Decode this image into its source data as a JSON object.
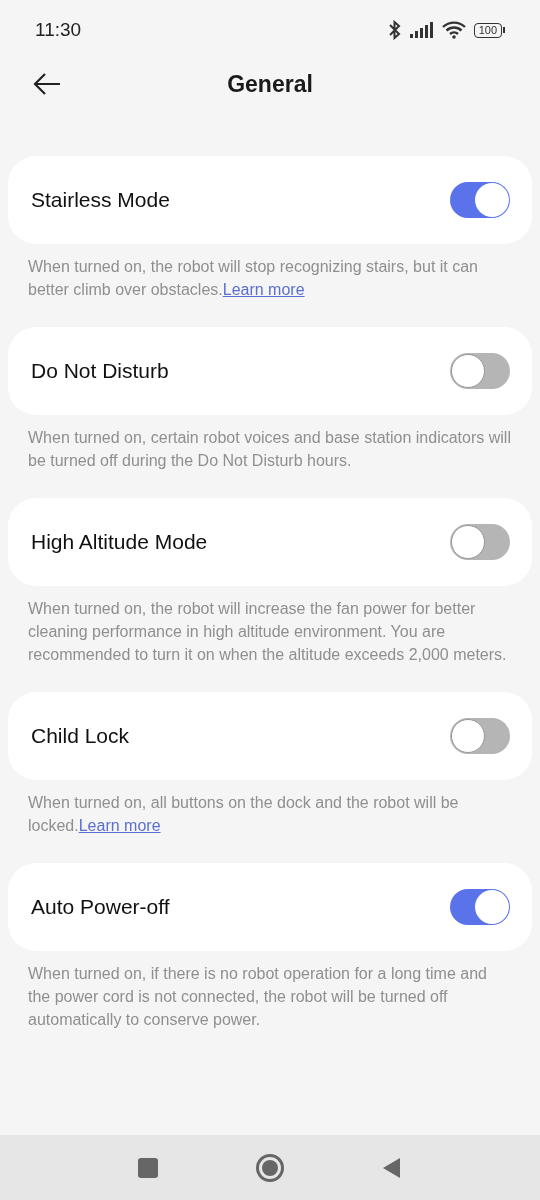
{
  "status_bar": {
    "time": "11:30",
    "battery": "100"
  },
  "header": {
    "title": "General"
  },
  "settings": [
    {
      "label": "Stairless Mode",
      "on": true,
      "description": "When turned on, the robot will stop recognizing stairs, but it can better climb over obstacles.",
      "link": "Learn more"
    },
    {
      "label": "Do Not Disturb",
      "on": false,
      "description": "When turned on, certain robot voices and base station indicators will be turned off during the Do Not Disturb hours."
    },
    {
      "label": "High Altitude Mode",
      "on": false,
      "description": "When turned on, the robot will increase the fan power for better cleaning performance in high altitude environment. You are recommended to turn it on when the altitude exceeds 2,000 meters."
    },
    {
      "label": "Child Lock",
      "on": false,
      "description": "When turned on, all buttons on the dock and the robot will be locked.",
      "link": "Learn more"
    },
    {
      "label": "Auto Power-off",
      "on": true,
      "description": "When turned on, if there is no robot operation for a long time and the power cord is not connected, the robot will be turned off automatically to conserve power."
    }
  ]
}
